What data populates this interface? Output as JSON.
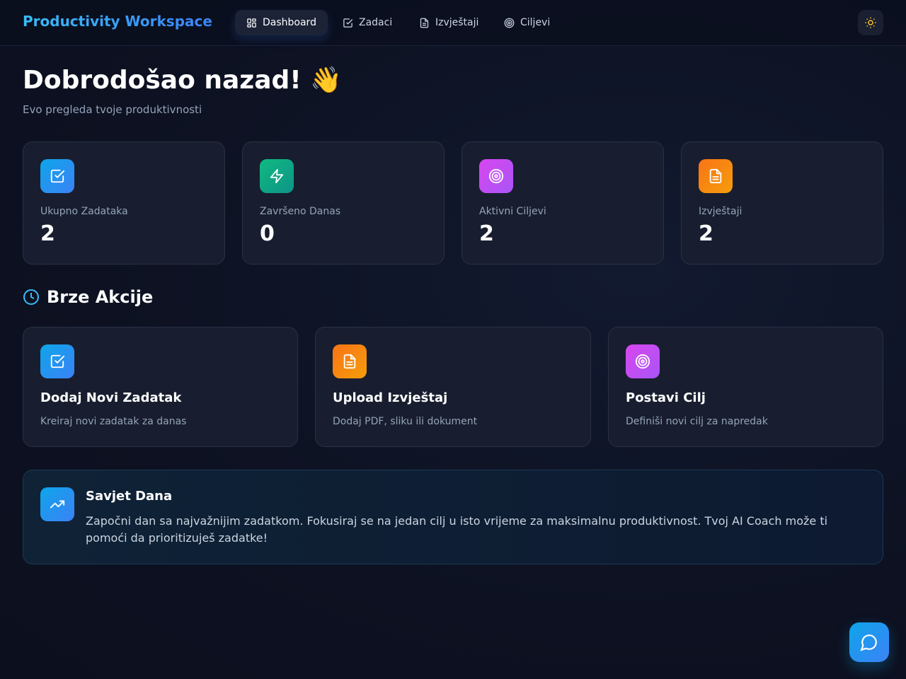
{
  "app": {
    "title": "Productivity Workspace"
  },
  "nav": {
    "tabs": [
      {
        "label": "Dashboard",
        "icon": "grid-icon",
        "active": true
      },
      {
        "label": "Zadaci",
        "icon": "checkbox-icon",
        "active": false
      },
      {
        "label": "Izvještaji",
        "icon": "document-icon",
        "active": false
      },
      {
        "label": "Ciljevi",
        "icon": "target-icon",
        "active": false
      }
    ],
    "theme_toggle_icon": "sun-icon"
  },
  "welcome": {
    "title": "Dobrodošao nazad! 👋",
    "subtitle": "Evo pregleda tvoje produktivnosti"
  },
  "stats": [
    {
      "label": "Ukupno Zadataka",
      "value": "2",
      "icon": "checkbox-icon",
      "color": "#0ea5e9"
    },
    {
      "label": "Završeno Danas",
      "value": "0",
      "icon": "lightning-icon",
      "color": "#10b981"
    },
    {
      "label": "Aktivni Ciljevi",
      "value": "2",
      "icon": "target-icon",
      "color": "#d946ef"
    },
    {
      "label": "Izvještaji",
      "value": "2",
      "icon": "document-icon",
      "color": "#f97316"
    }
  ],
  "quick_actions": {
    "title": "Brze Akcije",
    "icon": "clock-icon",
    "items": [
      {
        "title": "Dodaj Novi Zadatak",
        "description": "Kreiraj novi zadatak za danas",
        "icon": "checkbox-icon",
        "color": "#0ea5e9"
      },
      {
        "title": "Upload Izvještaj",
        "description": "Dodaj PDF, sliku ili dokument",
        "icon": "document-icon",
        "color": "#f97316"
      },
      {
        "title": "Postavi Cilj",
        "description": "Definiši novi cilj za napredak",
        "icon": "target-icon",
        "color": "#d946ef"
      }
    ]
  },
  "tip": {
    "title": "Savjet Dana",
    "text": "Započni dan sa najvažnijim zadatkom. Fokusiraj se na jedan cilj u isto vrijeme za maksimalnu produktivnost. Tvoj AI Coach može ti pomoći da prioritizuješ zadatke!",
    "icon": "trending-up-icon"
  },
  "chat_button_icon": "chat-bubble-icon"
}
